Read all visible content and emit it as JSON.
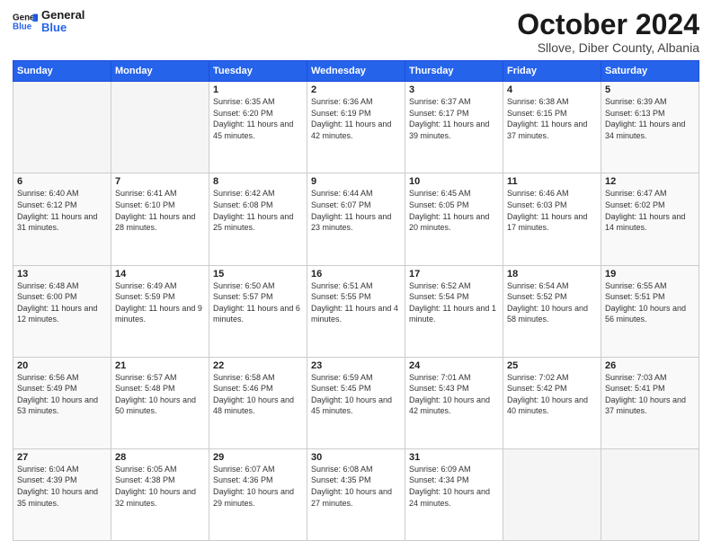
{
  "logo": {
    "line1": "General",
    "line2": "Blue"
  },
  "title": "October 2024",
  "subtitle": "Sllove, Diber County, Albania",
  "weekdays": [
    "Sunday",
    "Monday",
    "Tuesday",
    "Wednesday",
    "Thursday",
    "Friday",
    "Saturday"
  ],
  "weeks": [
    [
      {
        "day": "",
        "info": ""
      },
      {
        "day": "",
        "info": ""
      },
      {
        "day": "1",
        "info": "Sunrise: 6:35 AM\nSunset: 6:20 PM\nDaylight: 11 hours and 45 minutes."
      },
      {
        "day": "2",
        "info": "Sunrise: 6:36 AM\nSunset: 6:19 PM\nDaylight: 11 hours and 42 minutes."
      },
      {
        "day": "3",
        "info": "Sunrise: 6:37 AM\nSunset: 6:17 PM\nDaylight: 11 hours and 39 minutes."
      },
      {
        "day": "4",
        "info": "Sunrise: 6:38 AM\nSunset: 6:15 PM\nDaylight: 11 hours and 37 minutes."
      },
      {
        "day": "5",
        "info": "Sunrise: 6:39 AM\nSunset: 6:13 PM\nDaylight: 11 hours and 34 minutes."
      }
    ],
    [
      {
        "day": "6",
        "info": "Sunrise: 6:40 AM\nSunset: 6:12 PM\nDaylight: 11 hours and 31 minutes."
      },
      {
        "day": "7",
        "info": "Sunrise: 6:41 AM\nSunset: 6:10 PM\nDaylight: 11 hours and 28 minutes."
      },
      {
        "day": "8",
        "info": "Sunrise: 6:42 AM\nSunset: 6:08 PM\nDaylight: 11 hours and 25 minutes."
      },
      {
        "day": "9",
        "info": "Sunrise: 6:44 AM\nSunset: 6:07 PM\nDaylight: 11 hours and 23 minutes."
      },
      {
        "day": "10",
        "info": "Sunrise: 6:45 AM\nSunset: 6:05 PM\nDaylight: 11 hours and 20 minutes."
      },
      {
        "day": "11",
        "info": "Sunrise: 6:46 AM\nSunset: 6:03 PM\nDaylight: 11 hours and 17 minutes."
      },
      {
        "day": "12",
        "info": "Sunrise: 6:47 AM\nSunset: 6:02 PM\nDaylight: 11 hours and 14 minutes."
      }
    ],
    [
      {
        "day": "13",
        "info": "Sunrise: 6:48 AM\nSunset: 6:00 PM\nDaylight: 11 hours and 12 minutes."
      },
      {
        "day": "14",
        "info": "Sunrise: 6:49 AM\nSunset: 5:59 PM\nDaylight: 11 hours and 9 minutes."
      },
      {
        "day": "15",
        "info": "Sunrise: 6:50 AM\nSunset: 5:57 PM\nDaylight: 11 hours and 6 minutes."
      },
      {
        "day": "16",
        "info": "Sunrise: 6:51 AM\nSunset: 5:55 PM\nDaylight: 11 hours and 4 minutes."
      },
      {
        "day": "17",
        "info": "Sunrise: 6:52 AM\nSunset: 5:54 PM\nDaylight: 11 hours and 1 minute."
      },
      {
        "day": "18",
        "info": "Sunrise: 6:54 AM\nSunset: 5:52 PM\nDaylight: 10 hours and 58 minutes."
      },
      {
        "day": "19",
        "info": "Sunrise: 6:55 AM\nSunset: 5:51 PM\nDaylight: 10 hours and 56 minutes."
      }
    ],
    [
      {
        "day": "20",
        "info": "Sunrise: 6:56 AM\nSunset: 5:49 PM\nDaylight: 10 hours and 53 minutes."
      },
      {
        "day": "21",
        "info": "Sunrise: 6:57 AM\nSunset: 5:48 PM\nDaylight: 10 hours and 50 minutes."
      },
      {
        "day": "22",
        "info": "Sunrise: 6:58 AM\nSunset: 5:46 PM\nDaylight: 10 hours and 48 minutes."
      },
      {
        "day": "23",
        "info": "Sunrise: 6:59 AM\nSunset: 5:45 PM\nDaylight: 10 hours and 45 minutes."
      },
      {
        "day": "24",
        "info": "Sunrise: 7:01 AM\nSunset: 5:43 PM\nDaylight: 10 hours and 42 minutes."
      },
      {
        "day": "25",
        "info": "Sunrise: 7:02 AM\nSunset: 5:42 PM\nDaylight: 10 hours and 40 minutes."
      },
      {
        "day": "26",
        "info": "Sunrise: 7:03 AM\nSunset: 5:41 PM\nDaylight: 10 hours and 37 minutes."
      }
    ],
    [
      {
        "day": "27",
        "info": "Sunrise: 6:04 AM\nSunset: 4:39 PM\nDaylight: 10 hours and 35 minutes."
      },
      {
        "day": "28",
        "info": "Sunrise: 6:05 AM\nSunset: 4:38 PM\nDaylight: 10 hours and 32 minutes."
      },
      {
        "day": "29",
        "info": "Sunrise: 6:07 AM\nSunset: 4:36 PM\nDaylight: 10 hours and 29 minutes."
      },
      {
        "day": "30",
        "info": "Sunrise: 6:08 AM\nSunset: 4:35 PM\nDaylight: 10 hours and 27 minutes."
      },
      {
        "day": "31",
        "info": "Sunrise: 6:09 AM\nSunset: 4:34 PM\nDaylight: 10 hours and 24 minutes."
      },
      {
        "day": "",
        "info": ""
      },
      {
        "day": "",
        "info": ""
      }
    ]
  ]
}
